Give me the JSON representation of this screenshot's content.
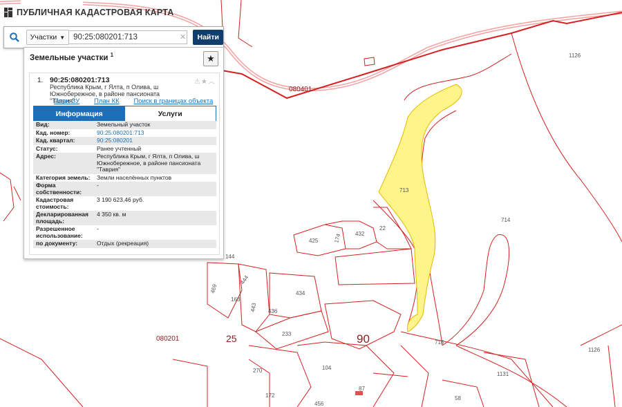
{
  "app": {
    "title": "ПУБЛИЧНАЯ КАДАСТРОВАЯ КАРТА"
  },
  "search": {
    "type_label": "Участки",
    "value": "90:25:080201:713",
    "button_label": "Найти"
  },
  "panel": {
    "heading": "Земельные участки",
    "count": "1",
    "result": {
      "index": "1.",
      "cad_number": "90:25:080201:713",
      "address": "Республика Крым, г Ялта, п Олива, ш Южнобережное, в районе пансионата \"Таврия\"",
      "links": [
        "План ЗУ →",
        "План КК →",
        "Поиск в границах объекта →"
      ],
      "tabs": [
        "Информация",
        "Услуги"
      ],
      "fields": [
        {
          "label": "Вид:",
          "value": "Земельный участок"
        },
        {
          "label": "Кад. номер:",
          "value": "90:25:080201:713"
        },
        {
          "label": "Кад. квартал:",
          "value": "90:25:080201"
        },
        {
          "label": "Статус:",
          "value": "Ранее учтенный"
        },
        {
          "label": "Адрес:",
          "value": "Республика Крым, г Ялта, п Олива, ш Южнобережное, в районе пансионата \"Таврия\""
        },
        {
          "label": "Категория земель:",
          "value": "Земли населённых пунктов"
        },
        {
          "label": "Форма собственности:",
          "value": "-"
        },
        {
          "label": "Кадастровая стоимость:",
          "value": "3 190 623,46 руб."
        },
        {
          "label": "Декларированная площадь:",
          "value": "4 350 кв. м"
        },
        {
          "label": "Разрешенное использование:",
          "value": "-"
        },
        {
          "label": "по документу:",
          "value": "Отдых (рекреация)"
        }
      ]
    }
  },
  "map": {
    "labels": [
      "1126",
      "080401",
      "713",
      "714",
      "22",
      "432",
      "425",
      "174",
      "144",
      "444",
      "469",
      "163",
      "443",
      "436",
      "434",
      "233",
      "90",
      "25",
      "080201",
      "715",
      "1126",
      "1131",
      "270",
      "104",
      "172",
      "87",
      "58",
      "456"
    ],
    "colors": {
      "boundary": "#d42020",
      "road": "#f2a0a0",
      "selected_fill": "#fdf58a"
    }
  }
}
